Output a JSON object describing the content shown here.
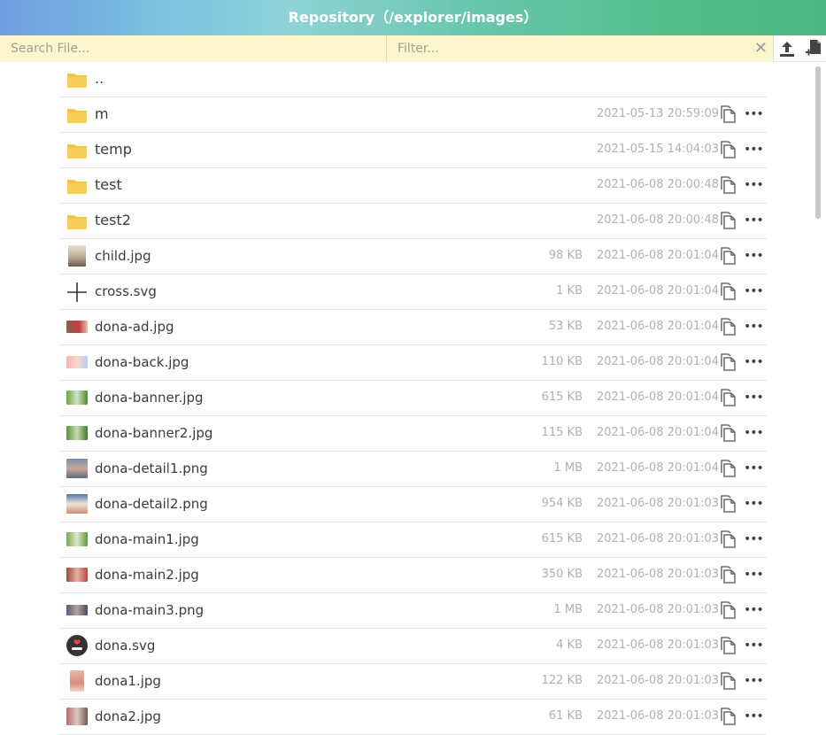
{
  "header": {
    "title": "Repository（/explorer/images）"
  },
  "toolbar": {
    "search_placeholder": "Search File...",
    "filter_placeholder": "Filter..."
  },
  "files": [
    {
      "name": "..",
      "type": "folder",
      "size": "",
      "date": ""
    },
    {
      "name": "m",
      "type": "folder",
      "size": "",
      "date": "2021-05-13 20:59:09"
    },
    {
      "name": "temp",
      "type": "folder",
      "size": "",
      "date": "2021-05-15 14:04:03"
    },
    {
      "name": "test",
      "type": "folder",
      "size": "",
      "date": "2021-06-08 20:00:48"
    },
    {
      "name": "test2",
      "type": "folder",
      "size": "",
      "date": "2021-06-08 20:00:48"
    },
    {
      "name": "child.jpg",
      "type": "image",
      "size": "98 KB",
      "date": "2021-06-08 20:01:04"
    },
    {
      "name": "cross.svg",
      "type": "cross",
      "size": "1 KB",
      "date": "2021-06-08 20:01:04"
    },
    {
      "name": "dona-ad.jpg",
      "type": "image",
      "size": "53 KB",
      "date": "2021-06-08 20:01:04"
    },
    {
      "name": "dona-back.jpg",
      "type": "image",
      "size": "110 KB",
      "date": "2021-06-08 20:01:04"
    },
    {
      "name": "dona-banner.jpg",
      "type": "image",
      "size": "615 KB",
      "date": "2021-06-08 20:01:04"
    },
    {
      "name": "dona-banner2.jpg",
      "type": "image",
      "size": "115 KB",
      "date": "2021-06-08 20:01:04"
    },
    {
      "name": "dona-detail1.png",
      "type": "image",
      "size": "1 MB",
      "date": "2021-06-08 20:01:04"
    },
    {
      "name": "dona-detail2.png",
      "type": "image",
      "size": "954 KB",
      "date": "2021-06-08 20:01:03"
    },
    {
      "name": "dona-main1.jpg",
      "type": "image",
      "size": "615 KB",
      "date": "2021-06-08 20:01:03"
    },
    {
      "name": "dona-main2.jpg",
      "type": "image",
      "size": "350 KB",
      "date": "2021-06-08 20:01:03"
    },
    {
      "name": "dona-main3.png",
      "type": "image",
      "size": "1 MB",
      "date": "2021-06-08 20:01:03"
    },
    {
      "name": "dona.svg",
      "type": "logo",
      "size": "4 KB",
      "date": "2021-06-08 20:01:03"
    },
    {
      "name": "dona1.jpg",
      "type": "image",
      "size": "122 KB",
      "date": "2021-06-08 20:01:03"
    },
    {
      "name": "dona2.jpg",
      "type": "image",
      "size": "61 KB",
      "date": "2021-06-08 20:01:03"
    }
  ],
  "colors": {
    "folder": "#f5c542",
    "search_bg": "#fdf5cc"
  }
}
